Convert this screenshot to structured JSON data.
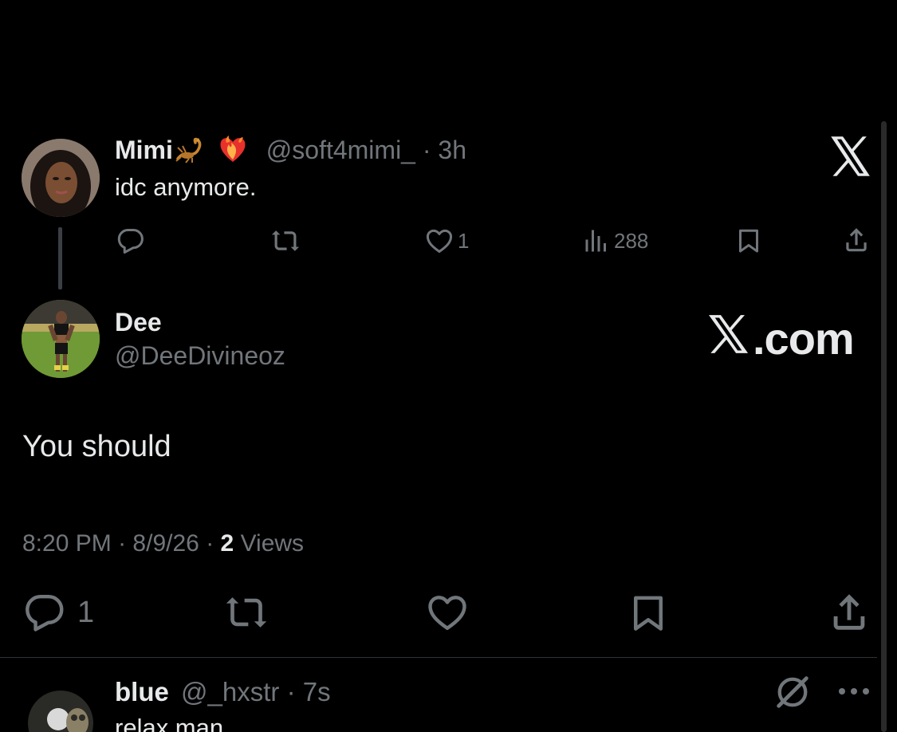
{
  "parent_tweet": {
    "display_name": "Mimi",
    "emojis": [
      "scorpion-emoji",
      "heart-on-fire-emoji"
    ],
    "handle": "@soft4mimi_",
    "separator": "·",
    "time": "3h",
    "text": "idc anymore.",
    "actions": {
      "reply_count": "",
      "retweet_count": "",
      "like_count": "1",
      "views_count": "288"
    }
  },
  "main_tweet": {
    "display_name": "Dee",
    "handle": "@DeeDivineoz",
    "text": "You should",
    "time": "8:20 PM",
    "date": "8/9/26",
    "views_count": "2",
    "views_label": "Views",
    "separator": "·",
    "reply_count": "1"
  },
  "watermark": {
    "logo": "x-logo-icon",
    "site_text": ".com"
  },
  "reply_tweet": {
    "display_name": "blue",
    "handle": "@_hxstr",
    "separator": "·",
    "time": "7s",
    "text": "relax man"
  },
  "colors": {
    "background": "#000000",
    "text": "#e7e9ea",
    "muted": "#71767b",
    "divider": "#2f3336"
  }
}
